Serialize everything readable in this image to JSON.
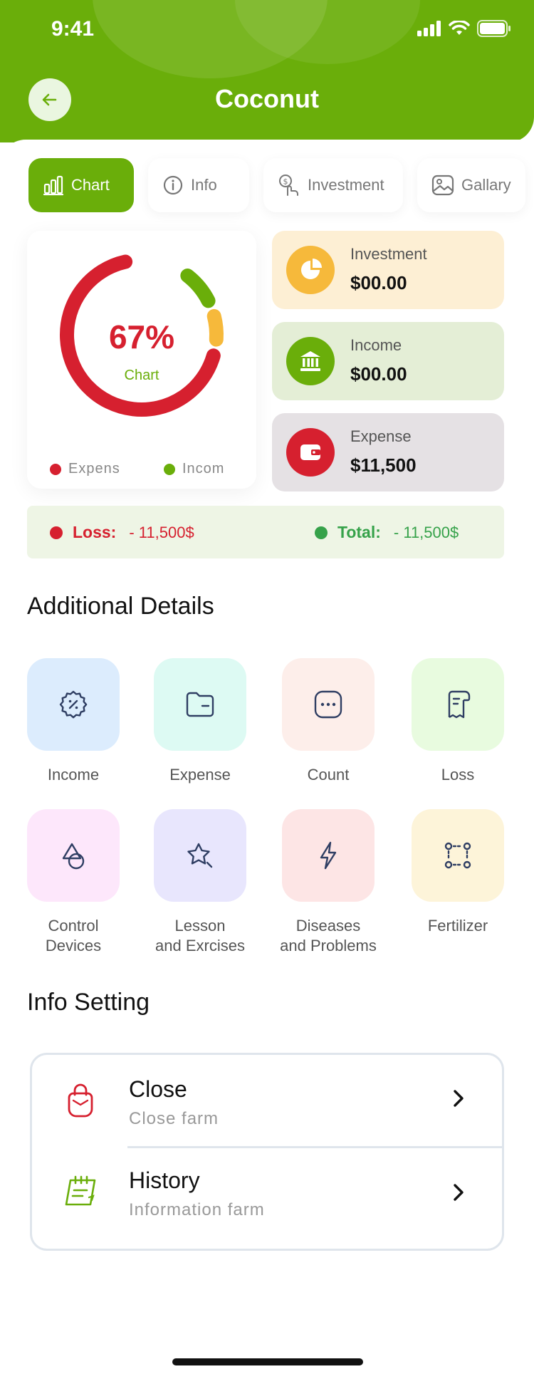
{
  "status_bar": {
    "time": "9:41"
  },
  "header": {
    "title": "Coconut"
  },
  "tabs": [
    {
      "label": "Chart",
      "icon": "bar-chart-icon"
    },
    {
      "label": "Info",
      "icon": "info-icon"
    },
    {
      "label": "Investment",
      "icon": "investment-icon"
    },
    {
      "label": "Gallary",
      "icon": "image-icon"
    }
  ],
  "chart_card": {
    "percent_text": "67%",
    "label": "Chart",
    "legend": [
      "Expens",
      "Incom"
    ],
    "colors": {
      "expense": "#d6202f",
      "income": "#6aae0a",
      "investment": "#f6b93b"
    },
    "segments": [
      {
        "name": "Expense",
        "fraction": 0.67
      },
      {
        "name": "Income",
        "fraction": 0.07
      },
      {
        "name": "Investment",
        "fraction": 0.05
      }
    ]
  },
  "stats": [
    {
      "label": "Investment",
      "value": "$00.00",
      "icon": "pie-chart-icon",
      "bg": "#fdefd4",
      "circle": "#f6b93b"
    },
    {
      "label": "Income",
      "value": "$00.00",
      "icon": "bank-icon",
      "bg": "#e4eed6",
      "circle": "#6aae0a"
    },
    {
      "label": "Expense",
      "value": "$11,500",
      "icon": "wallet-icon",
      "bg": "#e5e1e4",
      "circle": "#d6202f"
    }
  ],
  "summary": {
    "loss_label": "Loss:",
    "loss_value": "- 11,500$",
    "total_label": "Total:",
    "total_value": "- 11,500$"
  },
  "additional": {
    "title": "Additional Details",
    "items": [
      {
        "label": "Income",
        "icon": "discount-badge-icon",
        "bg": "#dcecfd"
      },
      {
        "label": "Expense",
        "icon": "folder-icon",
        "bg": "#ddfaf3"
      },
      {
        "label": "Count",
        "icon": "dots-square-icon",
        "bg": "#fdeeea"
      },
      {
        "label": "Loss",
        "icon": "receipt-icon",
        "bg": "#e8fbdf"
      },
      {
        "label": "Control\nDevices",
        "icon": "shapes-icon",
        "bg": "#fde7fb"
      },
      {
        "label": "Lesson\nand Exrcises",
        "icon": "star-cursor-icon",
        "bg": "#e8e6fd"
      },
      {
        "label": "Diseases\nand  Problems",
        "icon": "flash-icon",
        "bg": "#fde5e5"
      },
      {
        "label": "Fertilizer",
        "icon": "nodes-icon",
        "bg": "#fdf4d9"
      }
    ]
  },
  "info_setting": {
    "title": "Info Setting",
    "rows": [
      {
        "title": "Close",
        "subtitle": "Close farm",
        "icon": "bag-icon"
      },
      {
        "title": "History",
        "subtitle": "Information farm",
        "icon": "calendar-note-icon"
      }
    ]
  }
}
